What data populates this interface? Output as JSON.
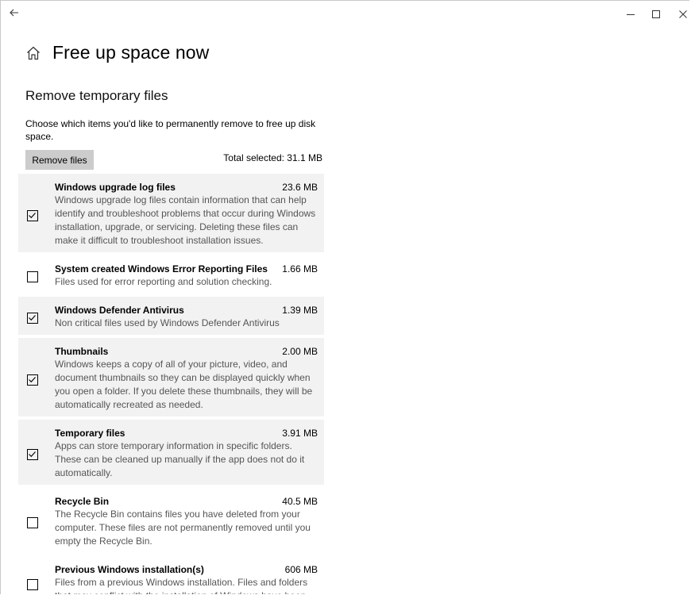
{
  "window": {
    "controls": {
      "minimize": "–",
      "maximize": "☐",
      "close": "✕"
    }
  },
  "header": {
    "title": "Free up space now"
  },
  "section": {
    "title": "Remove temporary files",
    "description": "Choose which items you'd like to permanently remove to free up disk space.",
    "remove_button": "Remove files",
    "total_selected": "Total selected: 31.1 MB"
  },
  "items": [
    {
      "name": "Windows upgrade log files",
      "size": "23.6 MB",
      "checked": true,
      "description": "Windows upgrade log files contain information that can help identify and troubleshoot problems that occur during Windows installation, upgrade, or servicing.  Deleting these files can make it difficult to troubleshoot installation issues."
    },
    {
      "name": "System created Windows Error Reporting Files",
      "size": "1.66 MB",
      "checked": false,
      "description": "Files used for error reporting and solution checking."
    },
    {
      "name": "Windows Defender Antivirus",
      "size": "1.39 MB",
      "checked": true,
      "description": "Non critical files used by Windows Defender Antivirus"
    },
    {
      "name": "Thumbnails",
      "size": "2.00 MB",
      "checked": true,
      "description": "Windows keeps a copy of all of your picture, video, and document thumbnails so they can be displayed quickly when you open a folder. If you delete these thumbnails, they will be automatically recreated as needed."
    },
    {
      "name": "Temporary files",
      "size": "3.91 MB",
      "checked": true,
      "description": "Apps can store temporary information in specific folders. These can be cleaned up manually if the app does not do it automatically."
    },
    {
      "name": "Recycle Bin",
      "size": "40.5 MB",
      "checked": false,
      "description": "The Recycle Bin contains files you have deleted from your computer. These files are not permanently removed until you empty the Recycle Bin."
    },
    {
      "name": "Previous Windows installation(s)",
      "size": "606 MB",
      "checked": false,
      "description": "Files from a previous Windows installation.  Files and folders that may conflict with the installation of Windows have been"
    }
  ]
}
